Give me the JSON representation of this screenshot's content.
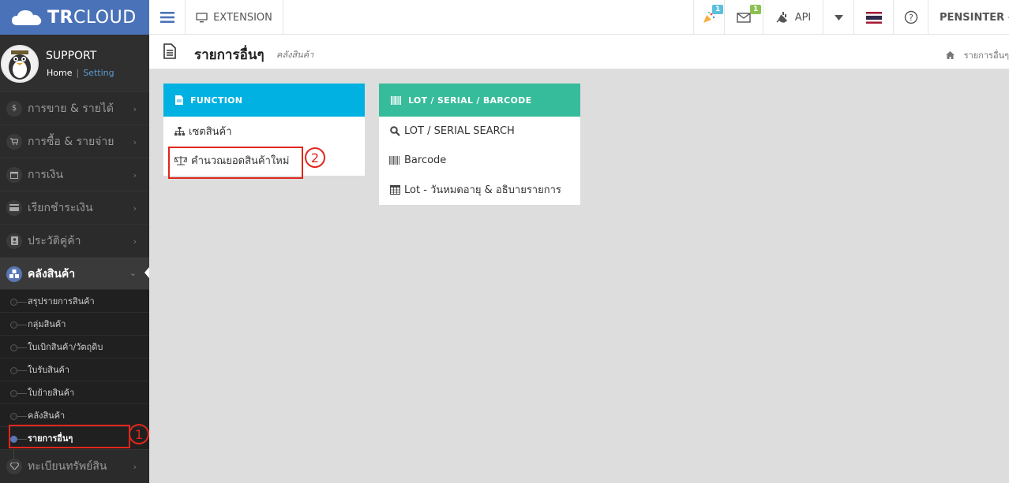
{
  "brand": {
    "bold": "TR",
    "light": "CLOUD"
  },
  "topbar": {
    "extension_label": "EXTENSION",
    "notify_badge": "1",
    "mail_badge": "1",
    "api_label": "API",
    "user_label": "PENSINTER"
  },
  "profile": {
    "name": "SUPPORT",
    "home": "Home",
    "separator": "|",
    "setting": "Setting"
  },
  "sidebar": {
    "menu": [
      {
        "label": "การขาย & รายได้",
        "icon": "dollar-icon"
      },
      {
        "label": "การซื้อ & รายจ่าย",
        "icon": "cart-icon"
      },
      {
        "label": "การเงิน",
        "icon": "calendar-icon"
      },
      {
        "label": "เรียกชำระเงิน",
        "icon": "credit-card-icon"
      },
      {
        "label": "ประวัติคู่ค้า",
        "icon": "contact-icon"
      },
      {
        "label": "คลังสินค้า",
        "icon": "cubes-icon"
      },
      {
        "label": "ทะเบียนทรัพย์สิน",
        "icon": "diamond-icon"
      }
    ],
    "sub": [
      {
        "label": "สรุปรายการสินค้า"
      },
      {
        "label": "กลุ่มสินค้า"
      },
      {
        "label": "ใบเบิกสินค้า/วัตถุดิบ"
      },
      {
        "label": "ใบรับสินค้า"
      },
      {
        "label": "ใบย้ายสินค้า"
      },
      {
        "label": "คลังสินค้า"
      },
      {
        "label": "รายการอื่นๆ"
      }
    ]
  },
  "page": {
    "title": "รายการอื่นๆ",
    "subtitle": "คลังสินค้า",
    "breadcrumb": "รายการอื่นๆ"
  },
  "function_panel": {
    "header": "FUNCTION",
    "color": "#00b1e1",
    "items": [
      {
        "label": "เซตสินค้า"
      },
      {
        "label": "คำนวณยอดสินค้าใหม่"
      }
    ]
  },
  "lot_panel": {
    "header": "LOT / SERIAL / BARCODE",
    "color": "#37bc9b",
    "items": [
      {
        "label": "LOT / SERIAL SEARCH"
      },
      {
        "label": "Barcode"
      },
      {
        "label": "Lot - วันหมดอายุ & อธิบายรายการ"
      }
    ]
  },
  "annotations": {
    "one": "1",
    "two": "2"
  }
}
